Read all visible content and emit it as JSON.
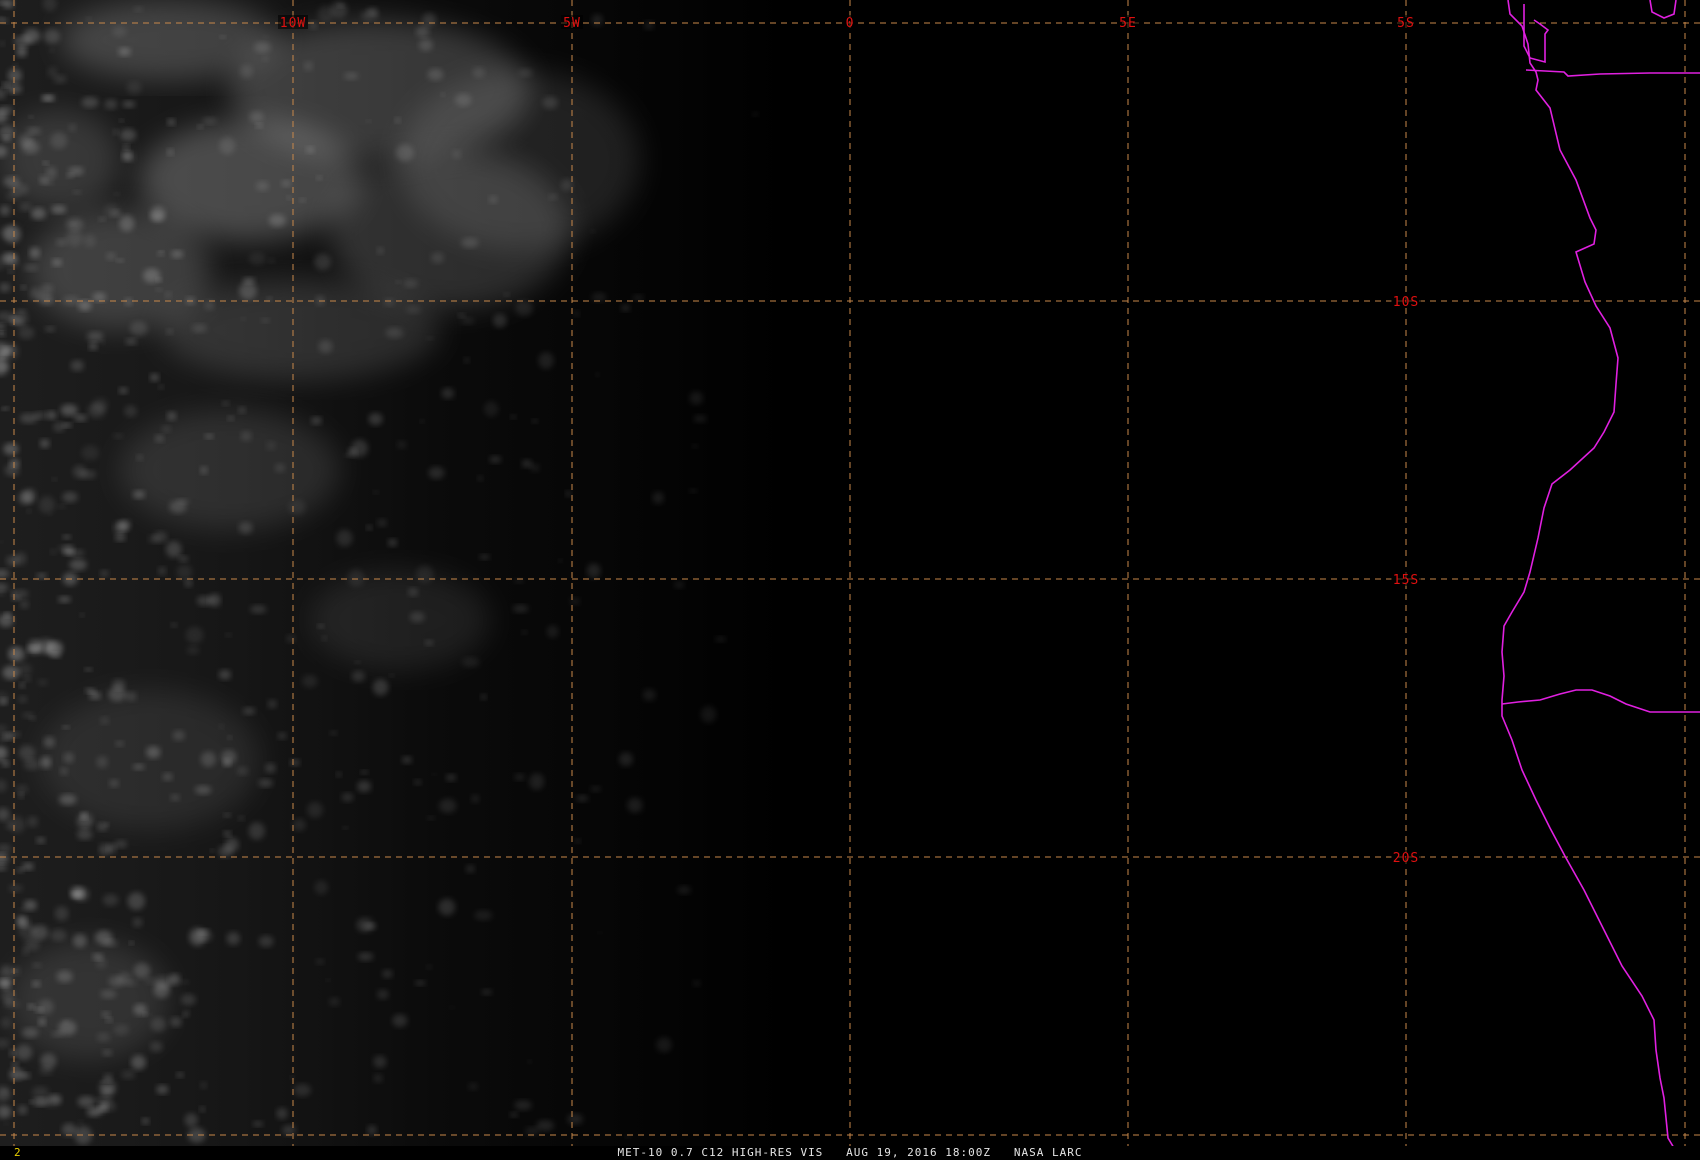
{
  "map": {
    "longitude_labels": [
      "10W",
      "5W",
      "0",
      "5E",
      "5S"
    ],
    "latitude_labels": [
      "10S",
      "15S",
      "20S"
    ],
    "colors": {
      "grid": "#c8884a",
      "grid_label": "#e01010",
      "boundary": "#e020e0",
      "background": "#000000"
    }
  },
  "status_bar": {
    "frame_number": "2",
    "caption": "MET-10 0.7 C12 HIGH-RES VIS   AUG 19, 2016 18:00Z   NASA LARC"
  }
}
